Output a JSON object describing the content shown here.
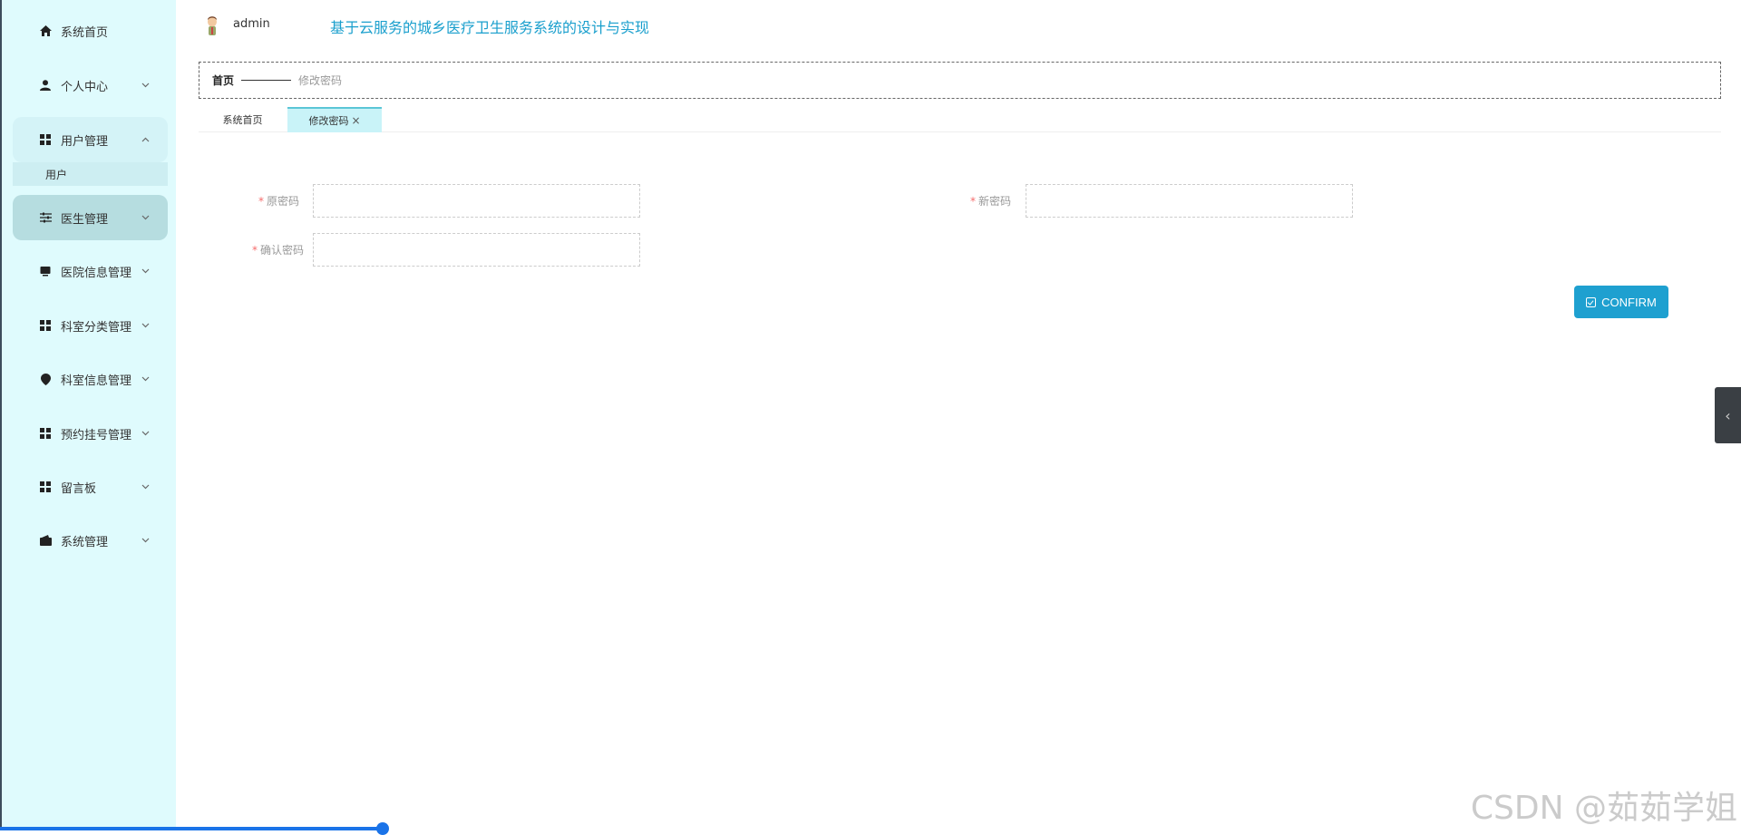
{
  "sidebar": {
    "items": [
      {
        "label": "系统首页",
        "icon": "home-icon"
      },
      {
        "label": "个人中心",
        "icon": "person-icon"
      },
      {
        "label": "用户管理",
        "icon": "grid-icon"
      },
      {
        "label": "医生管理",
        "icon": "sliders-icon"
      },
      {
        "label": "医院信息管理",
        "icon": "tv-icon"
      },
      {
        "label": "科室分类管理",
        "icon": "grid-icon"
      },
      {
        "label": "科室信息管理",
        "icon": "location-pin-icon"
      },
      {
        "label": "预约挂号管理",
        "icon": "grid-icon"
      },
      {
        "label": "留言板",
        "icon": "grid-icon"
      },
      {
        "label": "系统管理",
        "icon": "wallet-icon"
      }
    ],
    "submenu": {
      "label": "用户"
    }
  },
  "header": {
    "username": "admin",
    "title": "基于云服务的城乡医疗卫生服务系统的设计与实现"
  },
  "breadcrumb": {
    "home": "首页",
    "current": "修改密码"
  },
  "tabs": [
    {
      "label": "系统首页"
    },
    {
      "label": "修改密码",
      "close": "×"
    }
  ],
  "form": {
    "old_password_label": "原密码",
    "new_password_label": "新密码",
    "confirm_password_label": "确认密码",
    "required_mark": "*",
    "confirm_button": "CONFIRM"
  },
  "side_toggle": "‹",
  "progress": {
    "fraction": 0.22
  },
  "watermark": "CSDN @茹茹学姐",
  "colors": {
    "sidebar_bg": "#dffbfd",
    "accent": "#1ea0d0",
    "title": "#1a9fcd",
    "active_menu": "#b6dde0",
    "active_tab": "#c9f3f8"
  }
}
